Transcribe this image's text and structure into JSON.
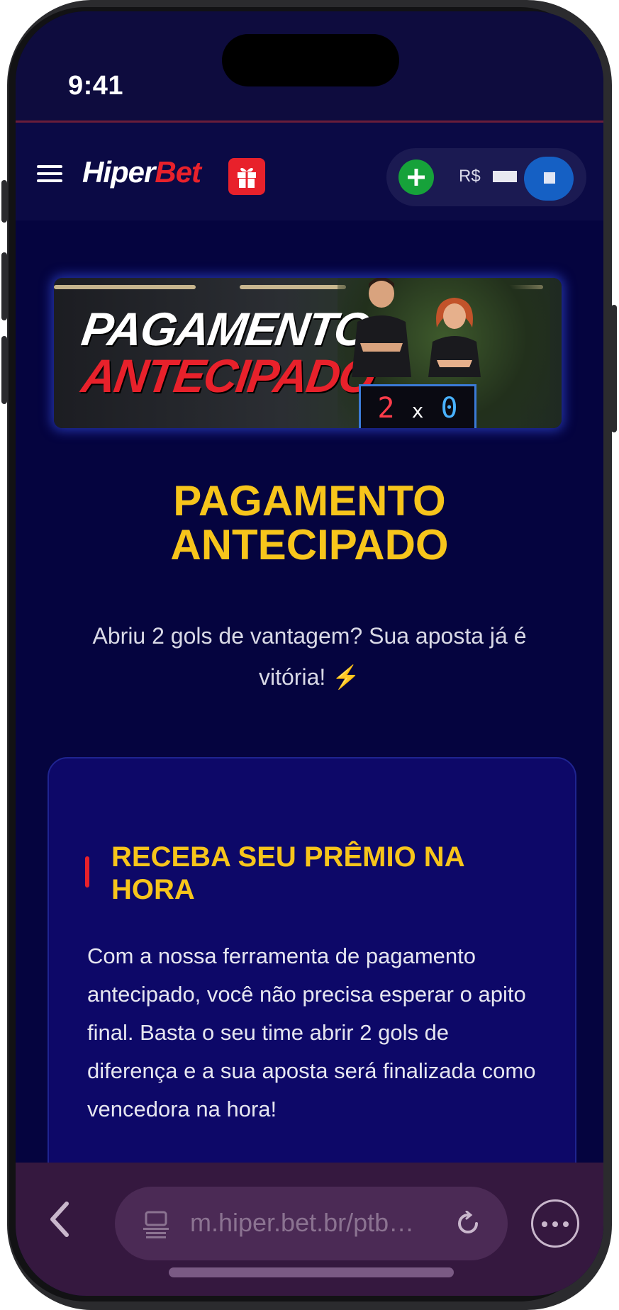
{
  "status": {
    "time": "9:41"
  },
  "header": {
    "logo_part1": "Hiper",
    "logo_part2": "Bet",
    "currency": "R$"
  },
  "banner": {
    "line1": "PAGAMENTO",
    "line2": "ANTECIPADO",
    "score_home": "2",
    "score_sep": "x",
    "score_away": "0"
  },
  "page": {
    "title_line1": "PAGAMENTO",
    "title_line2": "ANTECIPADO",
    "subtitle": "Abriu 2 gols de vantagem? Sua aposta já é vitória! ⚡"
  },
  "card": {
    "title": "RECEBA SEU PRÊMIO NA HORA",
    "text": "Com a nossa ferramenta de pagamento antecipado, você não precisa esperar o apito final. Basta o seu time abrir 2 gols de diferença e a sua aposta será finalizada como vencedora na hora!"
  },
  "browser": {
    "url": "m.hiper.bet.br/ptb…"
  },
  "colors": {
    "accent_yellow": "#f7c51b",
    "brand_red": "#e8212b",
    "background": "#05043f",
    "add_green": "#16a23a"
  },
  "icons": [
    "menu-icon",
    "gift-icon",
    "plus-icon",
    "back-icon",
    "tabs-icon",
    "reload-icon",
    "more-icon"
  ]
}
